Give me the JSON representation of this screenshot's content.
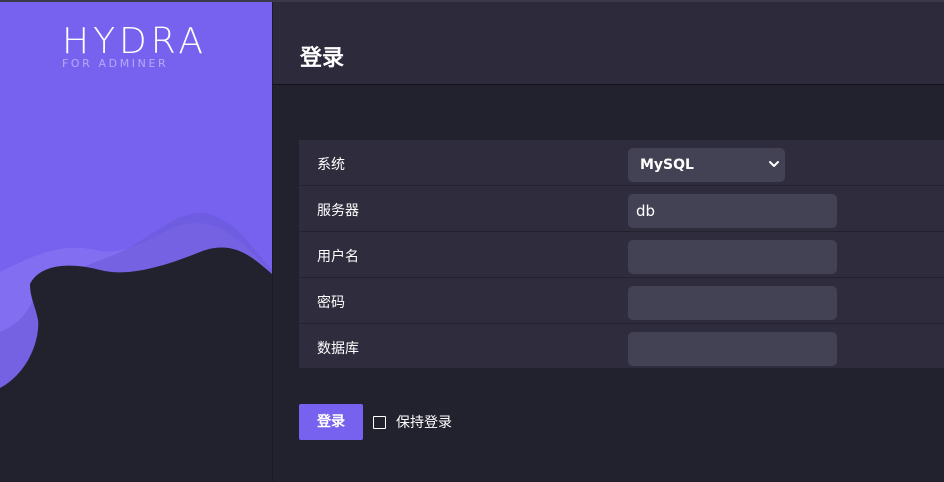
{
  "brand": {
    "wordmark": "HYDRA",
    "tagline": "FOR ADMINER",
    "accent_color": "#7762f0"
  },
  "header": {
    "title": "登录"
  },
  "form": {
    "rows": [
      {
        "label": "系统",
        "type": "select",
        "value": "MySQL"
      },
      {
        "label": "服务器",
        "type": "input",
        "value": "db"
      },
      {
        "label": "用户名",
        "type": "input",
        "value": ""
      },
      {
        "label": "密码",
        "type": "password",
        "value": ""
      },
      {
        "label": "数据库",
        "type": "input",
        "value": ""
      }
    ]
  },
  "footer": {
    "login_label": "登录",
    "remember_label": "保持登录",
    "remember_checked": false
  }
}
